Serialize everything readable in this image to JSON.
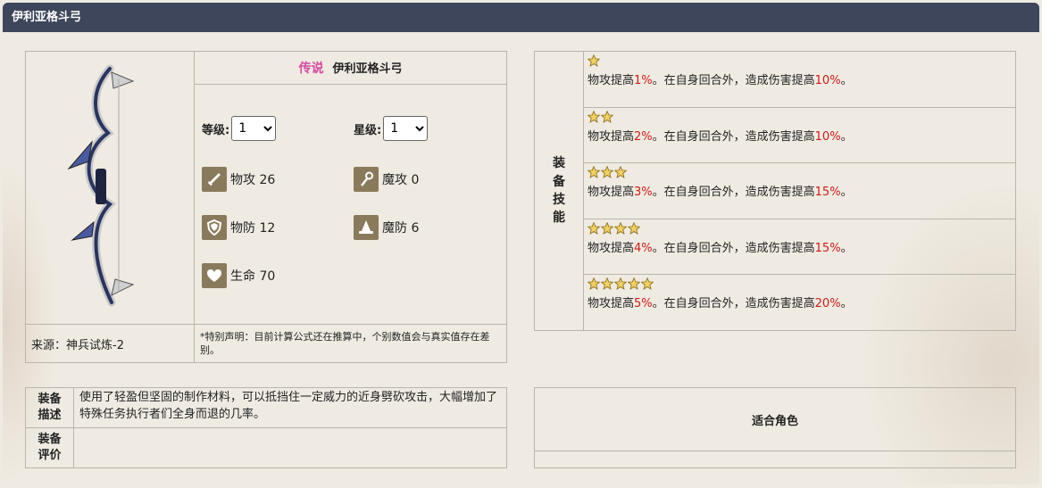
{
  "header": {
    "title": "伊利亚格斗弓"
  },
  "item": {
    "rarity": "传说",
    "name": "伊利亚格斗弓",
    "level_label": "等级:",
    "level_value": "1",
    "star_label": "星级:",
    "star_value": "1",
    "stats": [
      {
        "icon": "sword-icon",
        "label": "物攻 26"
      },
      {
        "icon": "magic-staff-icon",
        "label": "魔攻 0"
      },
      {
        "icon": "shield-icon",
        "label": "物防 12"
      },
      {
        "icon": "wizard-hat-icon",
        "label": "魔防 6"
      },
      {
        "icon": "heart-icon",
        "label": "生命 70"
      }
    ],
    "source": "来源：神兵试炼-2",
    "note": "*特别声明：目前计算公式还在推算中，个别数值会与真实值存在差别。"
  },
  "skills": {
    "label": [
      "装",
      "备",
      "技",
      "能"
    ],
    "rows": [
      {
        "stars": 1,
        "p1": "物攻提高",
        "v1": "1%",
        "p2": "。在自身回合外，造成伤害提高",
        "v2": "10%",
        "p3": "。"
      },
      {
        "stars": 2,
        "p1": "物攻提高",
        "v1": "2%",
        "p2": "。在自身回合外，造成伤害提高",
        "v2": "10%",
        "p3": "。"
      },
      {
        "stars": 3,
        "p1": "物攻提高",
        "v1": "3%",
        "p2": "。在自身回合外，造成伤害提高",
        "v2": "15%",
        "p3": "。"
      },
      {
        "stars": 4,
        "p1": "物攻提高",
        "v1": "4%",
        "p2": "。在自身回合外，造成伤害提高",
        "v2": "15%",
        "p3": "。"
      },
      {
        "stars": 5,
        "p1": "物攻提高",
        "v1": "5%",
        "p2": "。在自身回合外，造成伤害提高",
        "v2": "20%",
        "p3": "。"
      }
    ]
  },
  "description": {
    "desc_label_1": "装备",
    "desc_label_2": "描述",
    "desc_text": "使用了轻盈但坚固的制作材料，可以抵挡住一定威力的近身劈砍攻击，大幅增加了特殊任务执行者们全身而退的几率。",
    "eval_label_1": "装备",
    "eval_label_2": "评价",
    "eval_text": ""
  },
  "roles": {
    "title": "适合角色"
  },
  "colors": {
    "header_bg": "#3d465a",
    "highlight": "#d11a1a",
    "legend": "#d44ea0",
    "star_fill": "#f0d060"
  }
}
